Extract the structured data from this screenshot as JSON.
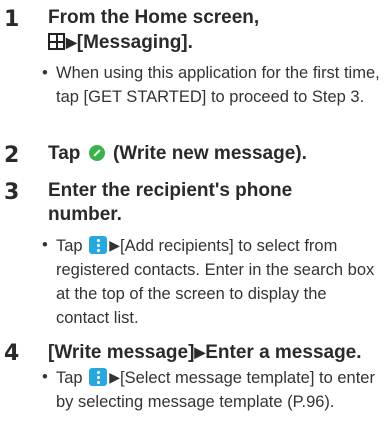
{
  "steps": [
    {
      "num": "1",
      "title_line1": "From the Home screen,",
      "title_line2": "[Messaging].",
      "notes": [
        "When using this application for the first time, tap [GET STARTED] to proceed to Step 3."
      ]
    },
    {
      "num": "2",
      "title_pre": "Tap",
      "title_post": "(Write new message)."
    },
    {
      "num": "3",
      "title_line1": "Enter the recipient's phone",
      "title_line2": "number.",
      "notes": [
        {
          "pre": "Tap",
          "post": "[Add recipients] to select from registered contacts. Enter in the search box at the top of the screen to display the contact list."
        }
      ]
    },
    {
      "num": "4",
      "title_pre": "[Write message]",
      "title_post": "Enter a message.",
      "notes": [
        {
          "pre": "Tap",
          "post": "[Select message template] to enter by selecting message template (P.96)."
        }
      ]
    }
  ],
  "bullet": "•",
  "arrow": "▶",
  "icons": {
    "apps": "apps-grid-icon",
    "write": "write-message-icon",
    "menu": "menu-more-icon"
  },
  "colors": {
    "menu_icon": "#29a8e0",
    "write_icon": "#3cb34a"
  }
}
